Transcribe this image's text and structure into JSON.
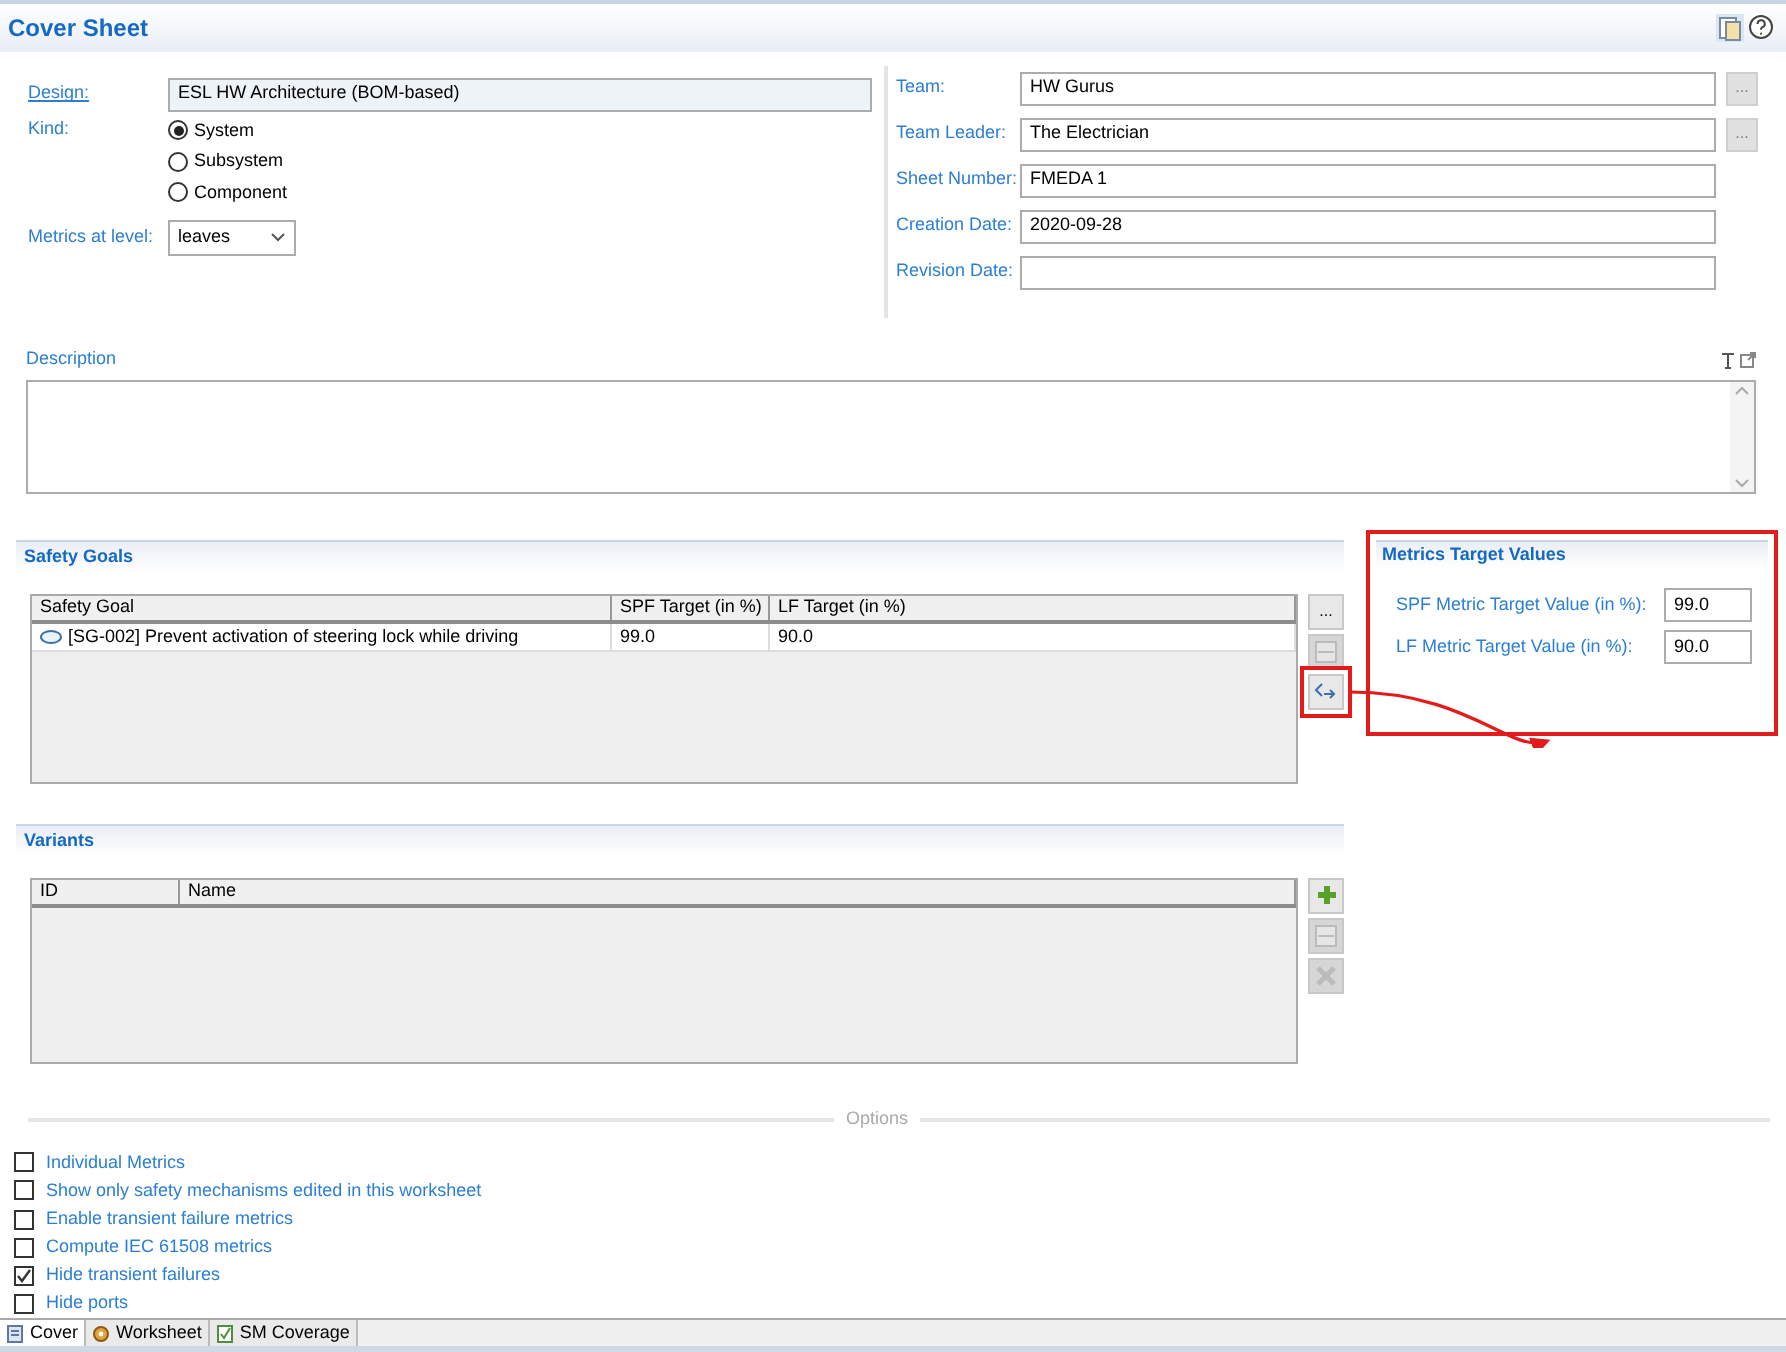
{
  "header": {
    "title": "Cover Sheet"
  },
  "design": {
    "label": "Design:",
    "value": "ESL HW Architecture (BOM-based)"
  },
  "kind": {
    "label": "Kind:",
    "options": [
      {
        "label": "System",
        "selected": true
      },
      {
        "label": "Subsystem",
        "selected": false
      },
      {
        "label": "Component",
        "selected": false
      }
    ]
  },
  "metrics_level": {
    "label": "Metrics at level:",
    "value": "leaves"
  },
  "team_fields": [
    {
      "label": "Team:",
      "value": "HW Gurus",
      "browse": "..."
    },
    {
      "label": "Team Leader:",
      "value": "The Electrician",
      "browse": "..."
    },
    {
      "label": "Sheet Number:",
      "value": "FMEDA 1"
    },
    {
      "label": "Creation Date:",
      "value": "2020-09-28"
    },
    {
      "label": "Revision Date:"
    }
  ],
  "description": {
    "label": "Description"
  },
  "safety_goals": {
    "title": "Safety Goals",
    "columns": [
      "Safety Goal",
      "SPF Target (in %)",
      "LF Target (in %)"
    ],
    "rows": [
      {
        "cells": [
          "[SG-002] Prevent activation of steering lock while driving",
          "99.0",
          "90.0"
        ]
      }
    ],
    "buttons": [
      {
        "kind": "more",
        "label": "...",
        "disabled": false,
        "highlighted": false
      },
      {
        "kind": "edit",
        "disabled": true,
        "highlighted": false
      },
      {
        "kind": "link",
        "disabled": false,
        "highlighted": true
      }
    ]
  },
  "metrics_targets": {
    "title": "Metrics Target Values",
    "fields": [
      {
        "label": "SPF Metric Target Value (in %):",
        "value": "99.0"
      },
      {
        "label": "LF Metric Target Value (in %):",
        "value": "90.0"
      }
    ]
  },
  "variants": {
    "title": "Variants",
    "columns": [
      "ID",
      "Name"
    ],
    "buttons": [
      {
        "kind": "add",
        "disabled": false
      },
      {
        "kind": "edit",
        "disabled": true
      },
      {
        "kind": "delete",
        "disabled": true
      }
    ]
  },
  "options": {
    "title": "Options",
    "items": [
      {
        "label": "Individual Metrics",
        "checked": false
      },
      {
        "label": "Show only safety mechanisms edited in this worksheet",
        "checked": false
      },
      {
        "label": "Enable transient failure metrics",
        "checked": false
      },
      {
        "label": "Compute IEC 61508 metrics",
        "checked": false
      },
      {
        "label": "Hide transient failures",
        "checked": true
      },
      {
        "label": "Hide ports",
        "checked": false
      }
    ]
  },
  "tabs": [
    {
      "kind": "cover",
      "label": "Cover",
      "selected": true
    },
    {
      "kind": "worksheet",
      "label": "Worksheet",
      "selected": false
    },
    {
      "kind": "coverage",
      "label": "SM Coverage",
      "selected": false
    }
  ]
}
